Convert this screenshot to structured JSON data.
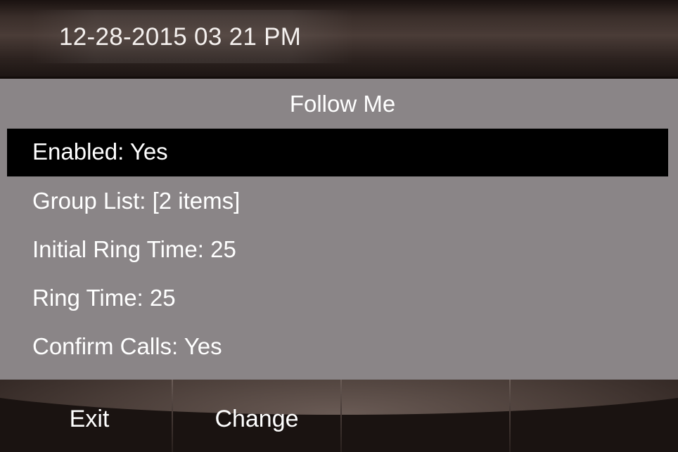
{
  "status_bar": {
    "datetime": "12-28-2015 03 21 PM"
  },
  "screen": {
    "title": "Follow Me"
  },
  "menu": {
    "items": [
      {
        "label": "Enabled: Yes",
        "selected": true
      },
      {
        "label": "Group List: [2 items]",
        "selected": false
      },
      {
        "label": "Initial Ring Time: 25",
        "selected": false
      },
      {
        "label": "Ring Time: 25",
        "selected": false
      },
      {
        "label": "Confirm Calls: Yes",
        "selected": false
      }
    ]
  },
  "softkeys": [
    {
      "label": "Exit"
    },
    {
      "label": "Change"
    },
    {
      "label": ""
    },
    {
      "label": ""
    }
  ],
  "colors": {
    "screen_background": "#8a8587",
    "selected_row": "#000000",
    "text": "#ffffff",
    "bar_dark": "#1a1311"
  }
}
